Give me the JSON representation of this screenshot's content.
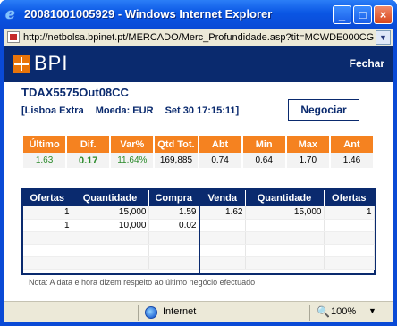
{
  "window": {
    "title": "20081001005929 - Windows Internet Explorer",
    "url": "http://netbolsa.bpinet.pt/MERCADO/Merc_Profundidade.asp?tit=MCWDE000CG"
  },
  "header": {
    "logo": "BPI",
    "close_label": "Fechar"
  },
  "instrument": {
    "name": "TDAX5575Out08CC",
    "market": "[Lisboa Extra",
    "currency": "Moeda: EUR",
    "datetime": "Set 30 17:15:11]",
    "trade_button": "Negociar"
  },
  "quote": {
    "headers": [
      "Último",
      "Dif.",
      "Var%",
      "Qtd Tot.",
      "Abt",
      "Min",
      "Max",
      "Ant"
    ],
    "values": [
      "1.63",
      "0.17",
      "11.64%",
      "169,885",
      "0.74",
      "0.64",
      "1.70",
      "1.46"
    ]
  },
  "order_book": {
    "left_headers": [
      "Ofertas",
      "Quantidade",
      "Compra"
    ],
    "right_headers": [
      "Venda",
      "Quantidade",
      "Ofertas"
    ],
    "rows": [
      {
        "bid_offers": "1",
        "bid_qty": "15,000",
        "bid": "1.59",
        "ask": "1.62",
        "ask_qty": "15,000",
        "ask_offers": "1"
      },
      {
        "bid_offers": "1",
        "bid_qty": "10,000",
        "bid": "0.02",
        "ask": "",
        "ask_qty": "",
        "ask_offers": ""
      },
      {
        "bid_offers": "",
        "bid_qty": "",
        "bid": "",
        "ask": "",
        "ask_qty": "",
        "ask_offers": ""
      },
      {
        "bid_offers": "",
        "bid_qty": "",
        "bid": "",
        "ask": "",
        "ask_qty": "",
        "ask_offers": ""
      },
      {
        "bid_offers": "",
        "bid_qty": "",
        "bid": "",
        "ask": "",
        "ask_qty": "",
        "ask_offers": ""
      }
    ]
  },
  "note": "Nota: A data e hora dizem respeito ao último negócio efectuado",
  "statusbar": {
    "zone": "Internet",
    "zoom": "100%"
  },
  "colors": {
    "bpi_navy": "#0a2a6e",
    "bpi_orange": "#f58220",
    "positive_green": "#2a8a2a"
  }
}
